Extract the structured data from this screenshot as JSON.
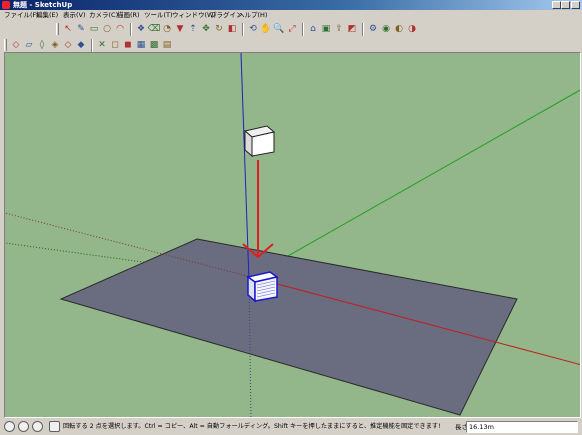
{
  "window": {
    "title": "無題 - SketchUp"
  },
  "menu": [
    "ファイル(F)",
    "編集(E)",
    "表示(V)",
    "カメラ(C)",
    "描画(R)",
    "ツール(T)",
    "ウィンドウ(W)",
    "プラグイン",
    "ヘルプ(H)"
  ],
  "toolbar1": {
    "tools": [
      {
        "name": "select-tool-icon",
        "glyph": "↖"
      },
      {
        "name": "pencil-tool-icon",
        "glyph": "✎"
      },
      {
        "name": "rectangle-tool-icon",
        "glyph": "▭"
      },
      {
        "name": "circle-tool-icon",
        "glyph": "○"
      },
      {
        "name": "arc-tool-icon",
        "glyph": "◠"
      },
      {
        "name": "make-component-icon",
        "glyph": "❖"
      },
      {
        "name": "eraser-tool-icon",
        "glyph": "⌫"
      },
      {
        "name": "tape-measure-icon",
        "glyph": "◔"
      },
      {
        "name": "paint-bucket-icon",
        "glyph": "▼"
      },
      {
        "name": "push-pull-icon",
        "glyph": "⇡"
      },
      {
        "name": "move-tool-icon",
        "glyph": "✥"
      },
      {
        "name": "rotate-tool-icon",
        "glyph": "↻"
      },
      {
        "name": "offset-tool-icon",
        "glyph": "◧"
      },
      {
        "name": "orbit-tool-icon",
        "glyph": "⟲"
      },
      {
        "name": "pan-tool-icon",
        "glyph": "✋"
      },
      {
        "name": "zoom-tool-icon",
        "glyph": "🔍"
      },
      {
        "name": "zoom-extents-icon",
        "glyph": "⤢"
      },
      {
        "name": "add-location-icon",
        "glyph": "⌂"
      },
      {
        "name": "get-models-icon",
        "glyph": "▣"
      },
      {
        "name": "share-model-icon",
        "glyph": "⇪"
      },
      {
        "name": "photo-textures-icon",
        "glyph": "◩"
      },
      {
        "name": "extension-warehouse-icon",
        "glyph": "⚙"
      },
      {
        "name": "components-icon",
        "glyph": "◉"
      },
      {
        "name": "materials-icon",
        "glyph": "◐"
      },
      {
        "name": "styles-icon",
        "glyph": "◑"
      }
    ]
  },
  "toolbar2": {
    "tools": [
      {
        "name": "view-iso-icon",
        "glyph": "◇"
      },
      {
        "name": "view-top-icon",
        "glyph": "▱"
      },
      {
        "name": "view-front-icon",
        "glyph": "◊"
      },
      {
        "name": "view-right-icon",
        "glyph": "◈"
      },
      {
        "name": "view-back-icon",
        "glyph": "◇"
      },
      {
        "name": "view-left-icon",
        "glyph": "◆"
      },
      {
        "name": "xray-icon",
        "glyph": "✕"
      },
      {
        "name": "wireframe-icon",
        "glyph": "◻"
      },
      {
        "name": "hidden-line-icon",
        "glyph": "◼"
      },
      {
        "name": "shaded-icon",
        "glyph": "▦"
      },
      {
        "name": "shaded-textures-icon",
        "glyph": "▩"
      },
      {
        "name": "monochrome-icon",
        "glyph": "▤"
      }
    ]
  },
  "status": {
    "text": "回転する 2 点を選択します。Ctrl = コピー、Alt = 自動フォールディング。Shift キーを押したままにすると、推定機能を固定できます!",
    "vcb_label": "長さ",
    "vcb_value": "16.13m"
  },
  "colors": {
    "sky": "#93b68a",
    "plane": "#6a6c80",
    "red_axis": "#c02020",
    "green_axis": "#20a020",
    "blue_axis": "#2020c0",
    "arrow": "#e02020"
  }
}
